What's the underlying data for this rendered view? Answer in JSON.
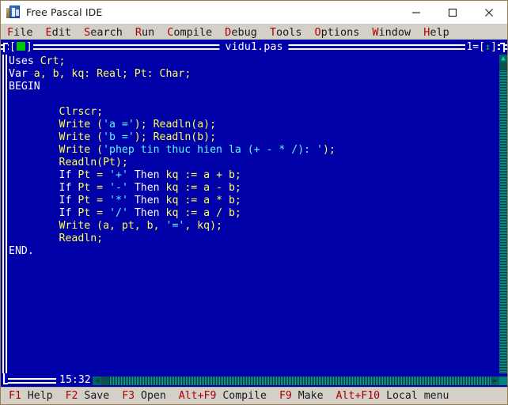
{
  "window": {
    "title": "Free Pascal IDE",
    "icon": "pascal-app-icon",
    "controls": {
      "minimize": "minimize-icon",
      "maximize": "maximize-icon",
      "close": "close-icon"
    }
  },
  "menubar": {
    "items": [
      {
        "hot": "F",
        "rest": "ile"
      },
      {
        "hot": "E",
        "rest": "dit"
      },
      {
        "hot": "S",
        "rest": "earch"
      },
      {
        "hot": "R",
        "rest": "un"
      },
      {
        "hot": "C",
        "rest": "ompile"
      },
      {
        "hot": "D",
        "rest": "ebug"
      },
      {
        "hot": "T",
        "rest": "ools"
      },
      {
        "hot": "O",
        "rest": "ptions"
      },
      {
        "hot": "W",
        "rest": "indow"
      },
      {
        "hot": "H",
        "rest": "elp"
      }
    ]
  },
  "editor": {
    "title": "vidu1.pas",
    "window_number": "1",
    "close_box": "[■]",
    "resize_glyph": "↕",
    "cursor_position": "15:32",
    "lines": [
      [
        {
          "t": "Uses ",
          "c": "kw"
        },
        {
          "t": "Crt;",
          "c": "id"
        }
      ],
      [
        {
          "t": "Var ",
          "c": "kw"
        },
        {
          "t": "a, b, kq: Real; Pt: Char;",
          "c": "id"
        }
      ],
      [
        {
          "t": "BEGIN",
          "c": "kw"
        }
      ],
      [
        {
          "t": "",
          "c": "id"
        }
      ],
      [
        {
          "t": "        Clrscr;",
          "c": "id"
        }
      ],
      [
        {
          "t": "        Write (",
          "c": "id"
        },
        {
          "t": "'a ='",
          "c": "str"
        },
        {
          "t": "); Readln(a);",
          "c": "id"
        }
      ],
      [
        {
          "t": "        Write (",
          "c": "id"
        },
        {
          "t": "'b ='",
          "c": "str"
        },
        {
          "t": "); Readln(b);",
          "c": "id"
        }
      ],
      [
        {
          "t": "        Write (",
          "c": "id"
        },
        {
          "t": "'phep tin thuc hien la (+ - * /): '",
          "c": "str"
        },
        {
          "t": ");",
          "c": "id"
        }
      ],
      [
        {
          "t": "        Readln(Pt);",
          "c": "id"
        }
      ],
      [
        {
          "t": "        ",
          "c": "id"
        },
        {
          "t": "If",
          "c": "kw"
        },
        {
          "t": " Pt = ",
          "c": "id"
        },
        {
          "t": "'+'",
          "c": "str"
        },
        {
          "t": " ",
          "c": "id"
        },
        {
          "t": "Then",
          "c": "kw"
        },
        {
          "t": " kq := a + b;",
          "c": "id"
        }
      ],
      [
        {
          "t": "        ",
          "c": "id"
        },
        {
          "t": "If",
          "c": "kw"
        },
        {
          "t": " Pt = ",
          "c": "id"
        },
        {
          "t": "'-'",
          "c": "str"
        },
        {
          "t": " ",
          "c": "id"
        },
        {
          "t": "Then",
          "c": "kw"
        },
        {
          "t": " kq := a - b;",
          "c": "id"
        }
      ],
      [
        {
          "t": "        ",
          "c": "id"
        },
        {
          "t": "If",
          "c": "kw"
        },
        {
          "t": " Pt = ",
          "c": "id"
        },
        {
          "t": "'*'",
          "c": "str"
        },
        {
          "t": " ",
          "c": "id"
        },
        {
          "t": "Then",
          "c": "kw"
        },
        {
          "t": " kq := a * b;",
          "c": "id"
        }
      ],
      [
        {
          "t": "        ",
          "c": "id"
        },
        {
          "t": "If",
          "c": "kw"
        },
        {
          "t": " Pt = ",
          "c": "id"
        },
        {
          "t": "'/'",
          "c": "str"
        },
        {
          "t": " ",
          "c": "id"
        },
        {
          "t": "Then",
          "c": "kw"
        },
        {
          "t": " kq := a / b;",
          "c": "id"
        }
      ],
      [
        {
          "t": "        Write (a, pt, b, ",
          "c": "id"
        },
        {
          "t": "'='",
          "c": "str"
        },
        {
          "t": ", kq);",
          "c": "id"
        }
      ],
      [
        {
          "t": "        Readln;",
          "c": "id"
        }
      ],
      [
        {
          "t": "END.",
          "c": "kw"
        }
      ]
    ]
  },
  "statusbar": {
    "items": [
      {
        "key": "F1",
        "label": " Help"
      },
      {
        "key": "F2",
        "label": " Save"
      },
      {
        "key": "F3",
        "label": " Open"
      },
      {
        "key": "Alt+F9",
        "label": " Compile"
      },
      {
        "key": "F9",
        "label": " Make"
      },
      {
        "key": "Alt+F10",
        "label": " Local menu"
      }
    ]
  },
  "colors": {
    "desktop_blue": "#0000a8",
    "keyword_white": "#ffffff",
    "identifier_yellow": "#ffff55",
    "string_cyan": "#55ffff",
    "menu_gray": "#d4d0c8",
    "hotkey_red": "#aa0000",
    "scrollbar_teal": "#008080",
    "close_green": "#00c800"
  }
}
